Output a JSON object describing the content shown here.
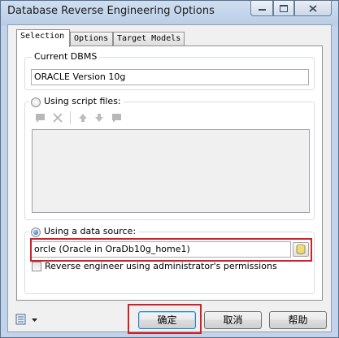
{
  "window": {
    "title": "Database Reverse Engineering Options"
  },
  "tabs": [
    {
      "label": "Selection",
      "active": true
    },
    {
      "label": "Options",
      "active": false
    },
    {
      "label": "Target Models",
      "active": false
    }
  ],
  "current_dbms": {
    "legend": "Current DBMS",
    "value": "ORACLE Version 10g"
  },
  "script_files": {
    "label": "Using script files:",
    "selected": false
  },
  "data_source": {
    "label": "Using a data source:",
    "selected": true,
    "value": "orcle (Oracle in OraDb10g_home1)",
    "admin_label": "Reverse engineer using administrator's permissions",
    "admin_checked": false
  },
  "buttons": {
    "ok": "确定",
    "cancel": "取消",
    "help": "帮助"
  },
  "colors": {
    "highlight": "#d0202a",
    "accent": "#3c7fb1"
  }
}
